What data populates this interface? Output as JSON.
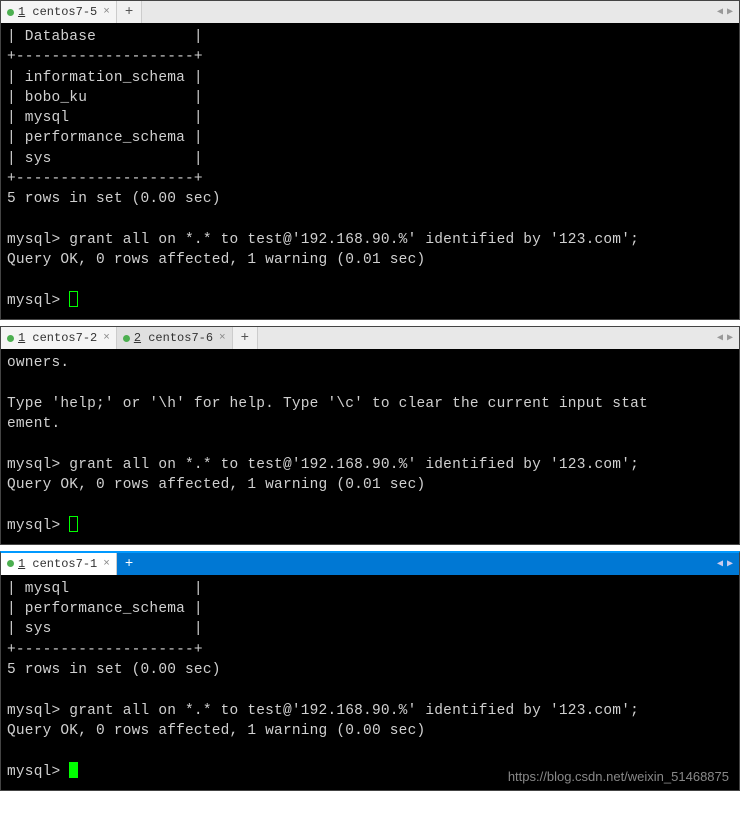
{
  "panes": [
    {
      "tabs": [
        {
          "num": "1",
          "name": "centos7-5",
          "close": "×"
        }
      ],
      "add": "+",
      "terminal_lines": [
        "| Database           |",
        "+--------------------+",
        "| information_schema |",
        "| bobo_ku            |",
        "| mysql              |",
        "| performance_schema |",
        "| sys                |",
        "+--------------------+",
        "5 rows in set (0.00 sec)",
        "",
        "mysql> grant all on *.* to test@'192.168.90.%' identified by '123.com';",
        "Query OK, 0 rows affected, 1 warning (0.01 sec)",
        "",
        "mysql> "
      ],
      "cursor_style": "outline"
    },
    {
      "tabs": [
        {
          "num": "1",
          "name": "centos7-2",
          "close": "×"
        },
        {
          "num": "2",
          "name": "centos7-6",
          "close": "×"
        }
      ],
      "add": "+",
      "terminal_lines": [
        "owners.",
        "",
        "Type 'help;' or '\\h' for help. Type '\\c' to clear the current input stat",
        "ement.",
        "",
        "mysql> grant all on *.* to test@'192.168.90.%' identified by '123.com';",
        "Query OK, 0 rows affected, 1 warning (0.01 sec)",
        "",
        "mysql> "
      ],
      "cursor_style": "outline"
    },
    {
      "active": true,
      "tabs": [
        {
          "num": "1",
          "name": "centos7-1",
          "close": "×"
        }
      ],
      "add": "+",
      "terminal_lines": [
        "| mysql              |",
        "| performance_schema |",
        "| sys                |",
        "+--------------------+",
        "5 rows in set (0.00 sec)",
        "",
        "mysql> grant all on *.* to test@'192.168.90.%' identified by '123.com';",
        "Query OK, 0 rows affected, 1 warning (0.00 sec)",
        "",
        "mysql> "
      ],
      "cursor_style": "solid"
    }
  ],
  "nav": {
    "left": "◀",
    "right": "▶"
  },
  "watermark": "https://blog.csdn.net/weixin_51468875"
}
